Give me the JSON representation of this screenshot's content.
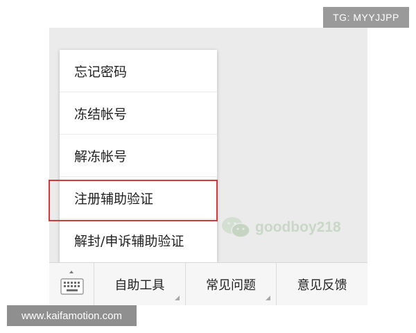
{
  "watermarks": {
    "tg_label": "TG: MYYJJPP",
    "account": "goodboy218",
    "site": "www.kaifamotion.com"
  },
  "popup_menu": {
    "items": [
      {
        "label": "忘记密码"
      },
      {
        "label": "冻结帐号"
      },
      {
        "label": "解冻帐号"
      },
      {
        "label": "注册辅助验证",
        "highlighted": true
      },
      {
        "label": "解封/申诉辅助验证"
      }
    ]
  },
  "bottom_bar": {
    "keyboard_icon": "keyboard-icon",
    "tabs": [
      {
        "label": "自助工具",
        "has_submenu": true
      },
      {
        "label": "常见问题",
        "has_submenu": true
      },
      {
        "label": "意见反馈",
        "has_submenu": false
      }
    ]
  },
  "colors": {
    "highlight_border": "#d23a3a",
    "chat_background": "#ebebeb",
    "bottom_bar_background": "#f6f6f6"
  }
}
